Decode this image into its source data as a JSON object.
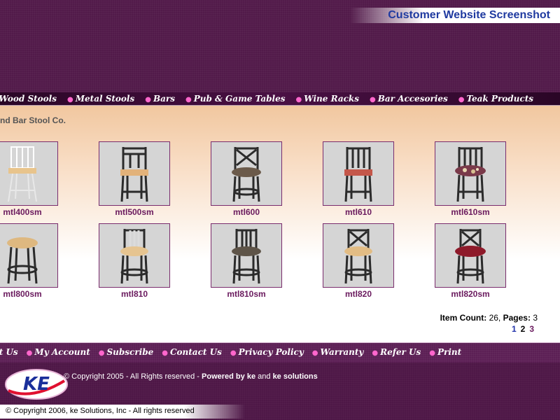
{
  "header": {
    "caption": "Customer Website Screenshot"
  },
  "nav": {
    "items": [
      "Wood Stools",
      "Metal Stools",
      "Bars",
      "Pub & Game Tables",
      "Wine Racks",
      "Bar Accesories",
      "Teak Products"
    ]
  },
  "main": {
    "heading": "nd Bar Stool Co.",
    "products": [
      {
        "name": "mtl400sm"
      },
      {
        "name": "mtl500sm"
      },
      {
        "name": "mtl600"
      },
      {
        "name": "mtl610"
      },
      {
        "name": "mtl610sm"
      },
      {
        "name": "mtl800sm"
      },
      {
        "name": "mtl810"
      },
      {
        "name": "mtl810sm"
      },
      {
        "name": "mtl820"
      },
      {
        "name": "mtl820sm"
      }
    ],
    "item_count_label": "Item Count:",
    "item_count": "26",
    "sep": ",",
    "pages_label": "Pages:",
    "pages_total": "3",
    "pages": [
      "1",
      "2",
      "3"
    ]
  },
  "bottom_nav": {
    "items": [
      "out Us",
      "My Account",
      "Subscribe",
      "Contact Us",
      "Privacy Policy",
      "Warranty",
      "Refer Us",
      "Print"
    ]
  },
  "footer": {
    "logo_text": "KE",
    "copyright_prefix": "© Copyright 2005 - All Rights reserved -",
    "powered_by": "Powered by ke",
    "and": "and",
    "ke_solutions": "ke solutions",
    "copyright2": "© Copyright 2006, ke Solutions, Inc - All rights reserved"
  },
  "colors": {
    "accent": "#1f3aa0",
    "brand": "#4e1747",
    "link": "#6a1a5e",
    "page_current": "#6a1a5e",
    "page_link": "#2233aa"
  }
}
